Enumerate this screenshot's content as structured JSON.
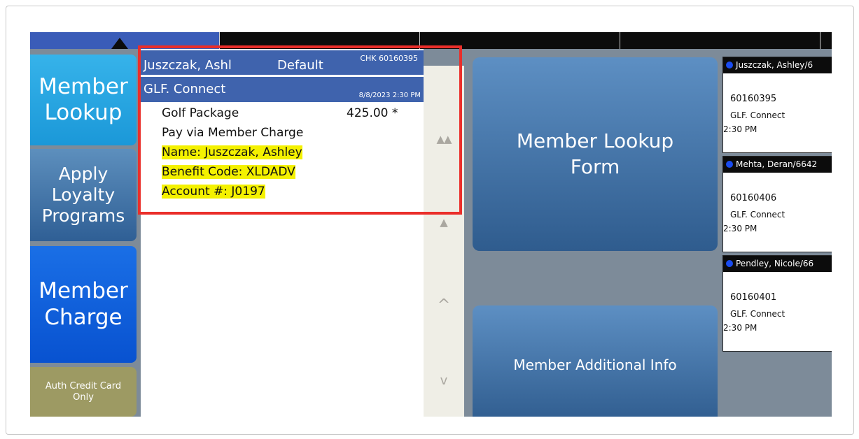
{
  "top_tabs": [
    "",
    "",
    "",
    "",
    ""
  ],
  "left_buttons": {
    "member_lookup": "Member\nLookup",
    "apply_loyalty": "Apply\nLoyalty\nPrograms",
    "member_charge": "Member\nCharge",
    "auth_credit": "Auth Credit Card\nOnly"
  },
  "check": {
    "name": "Juszczak, Ashl",
    "profile": "Default",
    "chk": "CHK 60160395",
    "group": "GLF. Connect",
    "datetime": "8/8/2023 2:30 PM",
    "item": "Golf Package",
    "price": "425.00  *",
    "lines": {
      "pay": "Pay via Member Charge",
      "name": "Name: Juszczak, Ashley",
      "benefit": "Benefit Code: XLDADV",
      "account": "Account #: J0197"
    }
  },
  "scroll_buttons": {
    "page_up": "▲▲",
    "top": "▲",
    "up": "^",
    "down": "v"
  },
  "main_buttons": {
    "lookup_form": "Member Lookup\nForm",
    "additional_info": "Member Additional Info"
  },
  "cards": [
    {
      "title": "Juszczak, Ashley/6",
      "check": "60160395",
      "group": "GLF. Connect",
      "time": "2:30 PM"
    },
    {
      "title": "Mehta, Deran/6642",
      "check": "60160406",
      "group": "GLF. Connect",
      "time": "2:30 PM"
    },
    {
      "title": "Pendley, Nicole/66",
      "check": "60160401",
      "group": "GLF. Connect",
      "time": "2:30 PM"
    }
  ]
}
